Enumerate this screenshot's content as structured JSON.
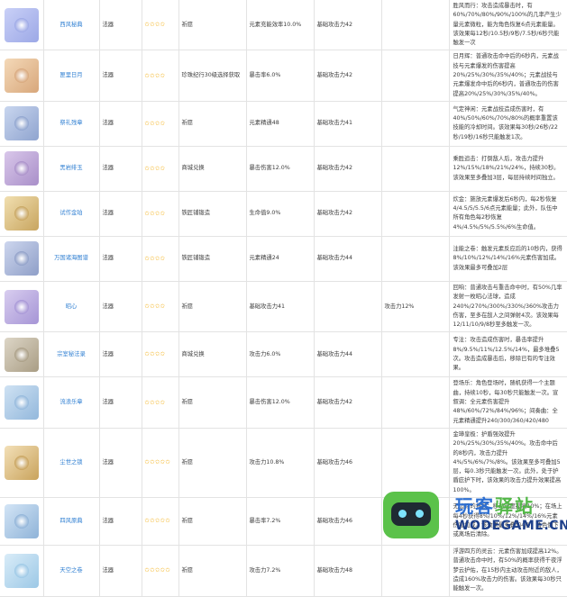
{
  "weapons": [
    {
      "name": "西风秘典",
      "type": "法器",
      "stars": "✩✩✩✩",
      "source": "祈愿",
      "stat": "元素充能效率10.0%",
      "base": "基础攻击力42",
      "extra": "",
      "effect": "胜风而行：攻击造成暴击时，有60%/70%/80%/90%/100%的几率产生少量元素微粒，能为角色恢复6点元素能量。该效果每12秒/10.5秒/9秒/7.5秒/6秒只能触发一次",
      "colors": [
        "#c9d0f7",
        "#9ca8e6"
      ]
    },
    {
      "name": "匣里日月",
      "type": "法器",
      "stars": "✩✩✩✩",
      "source": "珍珠纪行30级选择获取",
      "stat": "暴击率6.0%",
      "base": "基础攻击力42",
      "extra": "",
      "effect": "日月辉：普通攻击命中后的6秒内，元素战技与元素爆发的伤害提高20%/25%/30%/35%/40%；元素战技与元素爆发命中后的6秒内，普通攻击的伤害提高20%/25%/30%/35%/40%。",
      "colors": [
        "#f4d9b8",
        "#d8a77b"
      ]
    },
    {
      "name": "祭礼残章",
      "type": "法器",
      "stars": "✩✩✩✩",
      "source": "祈愿",
      "stat": "元素精通48",
      "base": "基础攻击力41",
      "extra": "",
      "effect": "气定神闲：元素战技造成伤害时，有40%/50%/60%/70%/80%的概率重置该技能的冷却时间。该效果每30秒/26秒/22秒/19秒/16秒只能触发1次。",
      "colors": [
        "#c9d6ef",
        "#8fa4cf"
      ]
    },
    {
      "name": "黑岩绯玉",
      "type": "法器",
      "stars": "✩✩✩✩",
      "source": "商城兑换",
      "stat": "暴击伤害12.0%",
      "base": "基础攻击力42",
      "extra": "",
      "effect": "乘胜追击：打倒敌人后，攻击力提升12%/15%/18%/21%/24%，持续30秒。该效果至多叠加3层，每层持续时间独立。",
      "colors": [
        "#d9c7ea",
        "#a98fc9"
      ]
    },
    {
      "name": "试作金珀",
      "type": "法器",
      "stars": "✩✩✩✩",
      "source": "铁匠铺锻造",
      "stat": "生命值9.0%",
      "base": "基础攻击力42",
      "extra": "",
      "effect": "炊金：施放元素爆发后6秒内，每2秒恢复4/4.5/5/5.5/6点元素能量；此外，队伍中所有角色每2秒恢复4%/4.5%/5%/5.5%/6%生命值。",
      "colors": [
        "#f1dfb0",
        "#c8a55f"
      ]
    },
    {
      "name": "万国诸海图谱",
      "type": "法器",
      "stars": "✩✩✩✩",
      "source": "铁匠铺锻造",
      "stat": "元素精通24",
      "base": "基础攻击力44",
      "extra": "",
      "effect": "注能之卷：触发元素反应后的10秒内，获得8%/10%/12%/14%/16%元素伤害加成。该效果最多可叠加2层",
      "colors": [
        "#cdd6ee",
        "#8f9fc8"
      ]
    },
    {
      "name": "昭心",
      "type": "法器",
      "stars": "✩✩✩✩",
      "source": "祈愿",
      "stat": "基础攻击力41",
      "base": "",
      "extra": "攻击力12%",
      "effect": "回响：普通攻击与重击命中时，有50%几率发射一枚昭心法球，造成240%/270%/300%/330%/360%攻击力伤害，至多在敌人之间弹射4次。该效果每12/11/10/9/8秒至多触发一次。",
      "colors": [
        "#d8cdef",
        "#a695d6"
      ]
    },
    {
      "name": "宗室秘法录",
      "type": "法器",
      "stars": "✩✩✩✩",
      "source": "商城兑换",
      "stat": "攻击力6.0%",
      "base": "基础攻击力44",
      "extra": "",
      "effect": "专注：攻击造成伤害时，暴击率提升8%/9.5%/11%/12.5%/14%，最多堆叠5次。攻击造成暴击后，移除已有的专注效果。",
      "colors": [
        "#ddd6c7",
        "#a99d84"
      ]
    },
    {
      "name": "流浪乐章",
      "type": "法器",
      "stars": "✩✩✩✩",
      "source": "祈愿",
      "stat": "暴击伤害12.0%",
      "base": "基础攻击力42",
      "extra": "",
      "effect": "登场乐：角色登场时，随机获得一个主题曲，持续10秒，每30秒只能触发一次。宣叙调：全元素伤害提升48%/60%/72%/84%/96%；间奏曲：全元素精通提升240/300/360/420/480",
      "colors": [
        "#cfe2f3",
        "#93b8dc"
      ]
    },
    {
      "name": "尘世之锁",
      "type": "法器",
      "stars": "✩✩✩✩✩",
      "source": "祈愿",
      "stat": "攻击力10.8%",
      "base": "基础攻击力46",
      "extra": "",
      "effect": "金璋皇极：护盾强效提升20%/25%/30%/35%/40%。攻击命中后的8秒内，攻击力提升4%/5%/6%/7%/8%。该效果至多可叠加5层，每0.3秒只能触发一次。此外，处于护盾庇护下时，该效果的攻击力提升效果提高100%。",
      "colors": [
        "#f3e0b8",
        "#c9a35c"
      ]
    },
    {
      "name": "四风原典",
      "type": "法器",
      "stars": "✩✩✩✩✩",
      "source": "祈愿",
      "stat": "暴击率7.2%",
      "base": "基础攻击力46",
      "extra": "",
      "effect": "无边际的眷顾：移动速度提高10%；在场上每4秒获得8%/10%/12%/14%/16%元素伤害加成。该效果最多叠加4层，角色倒下或离场后清除。",
      "colors": [
        "#d3e5f6",
        "#8fb3d8"
      ]
    },
    {
      "name": "天空之卷",
      "type": "法器",
      "stars": "✩✩✩✩✩",
      "source": "祈愿",
      "stat": "攻击力7.2%",
      "base": "基础攻击力48",
      "extra": "",
      "effect": "浮游四方的灵云：元素伤害加成提高12%。普通攻击命中时，有50%的概率获得千夜浮梦云护佑，在15秒内主动攻击附近的敌人，造成160%攻击力的伤害。该效果每30秒只能触发一次。",
      "colors": [
        "#d9ecf8",
        "#9cc8e6"
      ]
    }
  ],
  "watermark": {
    "cn1": "玩客",
    "cn2": "驿站",
    "en": "WODEGAME.CN"
  }
}
